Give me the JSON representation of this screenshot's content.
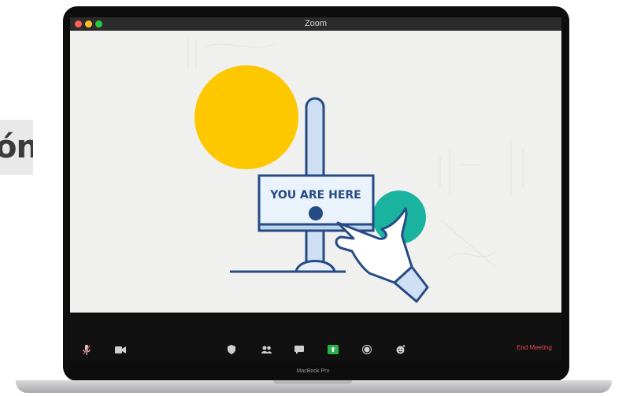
{
  "side_text": "ón",
  "window": {
    "title": "Zoom"
  },
  "slide": {
    "sign_text": "YOU ARE HERE"
  },
  "toolbar": {
    "end_meeting_label": "End Meeting"
  },
  "device": {
    "label": "MacBook Pro"
  },
  "colors": {
    "yellow_circle": "#fdc800",
    "teal_circle": "#19b3a0",
    "navy_outline": "#264b84",
    "end_meeting": "#e5484d"
  }
}
